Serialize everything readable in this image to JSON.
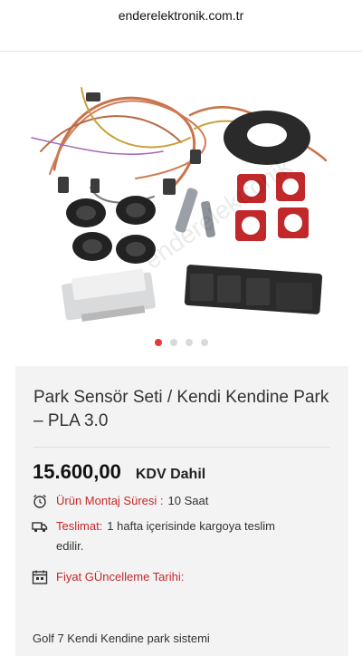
{
  "browser": {
    "url": "enderelektronik.com.tr"
  },
  "gallery": {
    "watermark": "enderelektronik",
    "slides": 4,
    "active_slide": 1,
    "colors": {
      "active_dot": "#e53935",
      "inactive_dot": "#d9d9d9"
    }
  },
  "product": {
    "title": "Park Sensör Seti / Kendi Kendine Park – PLA 3.0",
    "price": "15.600,00",
    "vat_label": "KDV Dahil",
    "install_label": "Ürün Montaj Süresi :",
    "install_value": "10 Saat",
    "delivery_label": "Teslimat:",
    "delivery_value": "1 hafta içerisinde kargoya teslim edilir.",
    "price_update_label": "Fiyat GÜncelleme Tarihi:",
    "description_start": "Golf 7 Kendi Kendine park sistemi",
    "icons": [
      "alarm-clock-icon",
      "truck-icon",
      "calendar-icon"
    ],
    "accent_color": "#c62828"
  }
}
